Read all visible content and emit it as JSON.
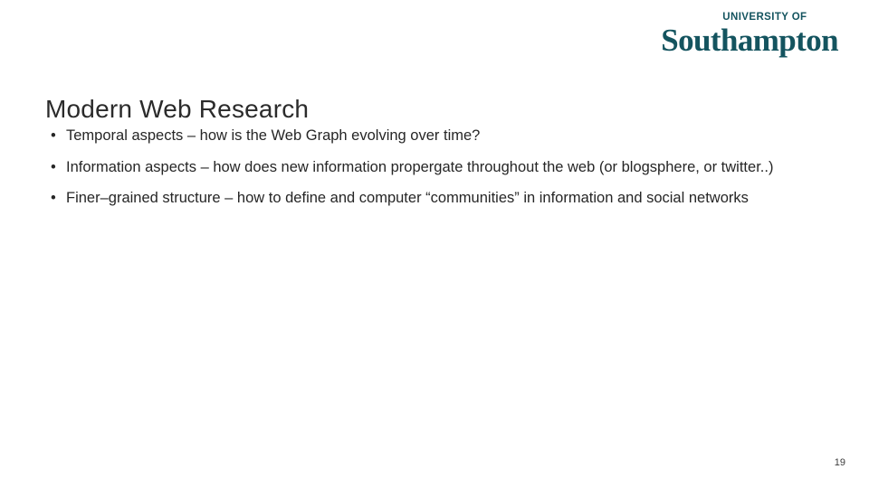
{
  "slide": {
    "page_number": "19",
    "title": "Modern Web Research",
    "background_color": "#ffffff",
    "text_color": "#262626"
  },
  "logo": {
    "top_line": "UNIVERSITY OF",
    "main_line": "Southampton",
    "color": "#14545f"
  },
  "bullets": [
    {
      "marker": "•",
      "text": "Temporal aspects – how is the Web Graph evolving over time?"
    },
    {
      "marker": "•",
      "text": "Information aspects – how does new information propergate throughout the web (or blogsphere, or twitter..)"
    },
    {
      "marker": "•",
      "text": "Finer–grained structure – how to define and computer “communities” in information and social networks"
    }
  ]
}
